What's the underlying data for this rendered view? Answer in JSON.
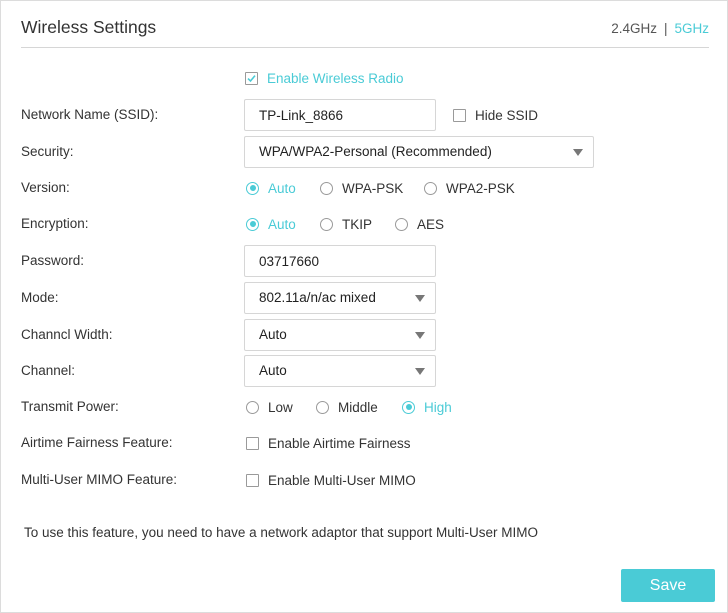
{
  "header": {
    "title": "Wireless Settings",
    "band_24": "2.4GHz",
    "band_sep": "|",
    "band_5": "5GHz"
  },
  "enable_radio": {
    "label": "Enable Wireless Radio",
    "checked": true
  },
  "ssid": {
    "label": "Network Name (SSID):",
    "value": "TP-Link_8866",
    "hide_label": "Hide SSID",
    "hide_checked": false
  },
  "security": {
    "label": "Security:",
    "value": "WPA/WPA2-Personal (Recommended)"
  },
  "version": {
    "label": "Version:",
    "options": [
      "Auto",
      "WPA-PSK",
      "WPA2-PSK"
    ],
    "selected": "Auto"
  },
  "encryption": {
    "label": "Encryption:",
    "options": [
      "Auto",
      "TKIP",
      "AES"
    ],
    "selected": "Auto"
  },
  "password": {
    "label": "Password:",
    "value": "03717660"
  },
  "mode": {
    "label": "Mode:",
    "value": "802.11a/n/ac mixed"
  },
  "channel_width": {
    "label": "Channcl Width:",
    "value": "Auto"
  },
  "channel": {
    "label": "Channel:",
    "value": "Auto"
  },
  "transmit_power": {
    "label": "Transmit Power:",
    "options": [
      "Low",
      "Middle",
      "High"
    ],
    "selected": "High"
  },
  "airtime": {
    "label": "Airtime Fairness Feature:",
    "option_label": "Enable Airtime Fairness",
    "checked": false
  },
  "mu_mimo": {
    "label": "Multi-User MIMO Feature:",
    "option_label": "Enable Multi-User MIMO",
    "checked": false
  },
  "note": "To use this feature, you need to have a network adaptor that support Multi-User MIMO",
  "save_label": "Save",
  "colors": {
    "accent": "#4acbd6",
    "text": "#333333",
    "border": "#d6d6d6"
  }
}
